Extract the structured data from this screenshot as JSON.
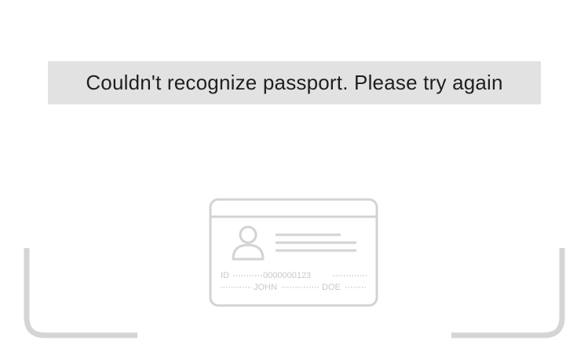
{
  "error": {
    "message": "Couldn't recognize passport. Please try again"
  },
  "id_card": {
    "id_label": "ID",
    "id_number": "0000000123",
    "first_name": "JOHN",
    "last_name": "DOE"
  },
  "colors": {
    "banner_bg": "#e2e2e2",
    "banner_text": "#1f1f1f",
    "frame": "#d5d5d5",
    "card_stroke": "#d3d3d3",
    "card_text": "#c8c8c8"
  },
  "icons": {
    "person": "person-silhouette-icon"
  }
}
